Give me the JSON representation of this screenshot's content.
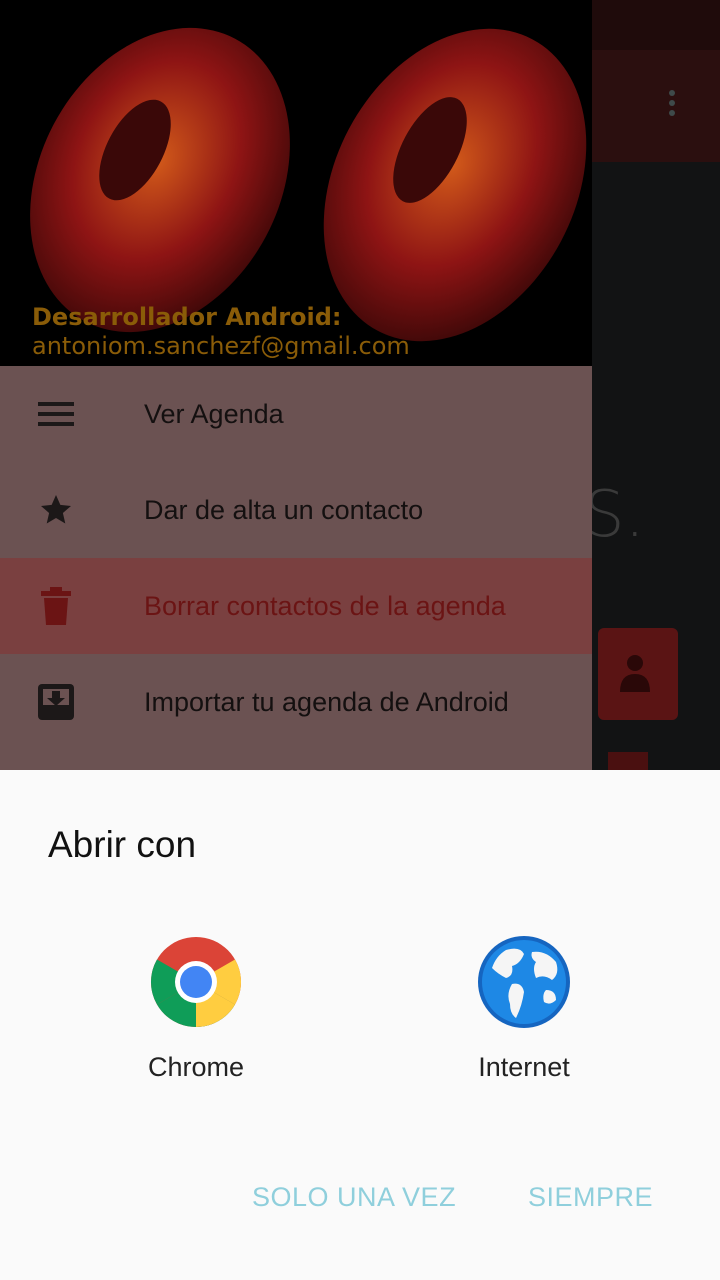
{
  "background": {
    "partial_letter": "S."
  },
  "drawer": {
    "header": {
      "title": "Desarrollador Android:",
      "email": "antoniom.sanchezf@gmail.com"
    },
    "items": [
      {
        "label": "Ver Agenda",
        "icon": "menu-icon",
        "active": false
      },
      {
        "label": "Dar de alta un contacto",
        "icon": "star-icon",
        "active": false
      },
      {
        "label": "Borrar contactos de la agenda",
        "icon": "trash-icon",
        "active": true
      },
      {
        "label": "Importar tu agenda de Android",
        "icon": "download-tray-icon",
        "active": false
      }
    ]
  },
  "sheet": {
    "title": "Abrir con",
    "apps": [
      {
        "label": "Chrome",
        "icon": "chrome-icon"
      },
      {
        "label": "Internet",
        "icon": "globe-icon"
      }
    ],
    "buttons": {
      "once": "SOLO UNA VEZ",
      "always": "SIEMPRE"
    }
  },
  "colors": {
    "accent_button": "#8fcfdc",
    "active_item_text": "#6b1414",
    "header_text": "#8a5c08",
    "drawer_bg": "#6b5252"
  }
}
